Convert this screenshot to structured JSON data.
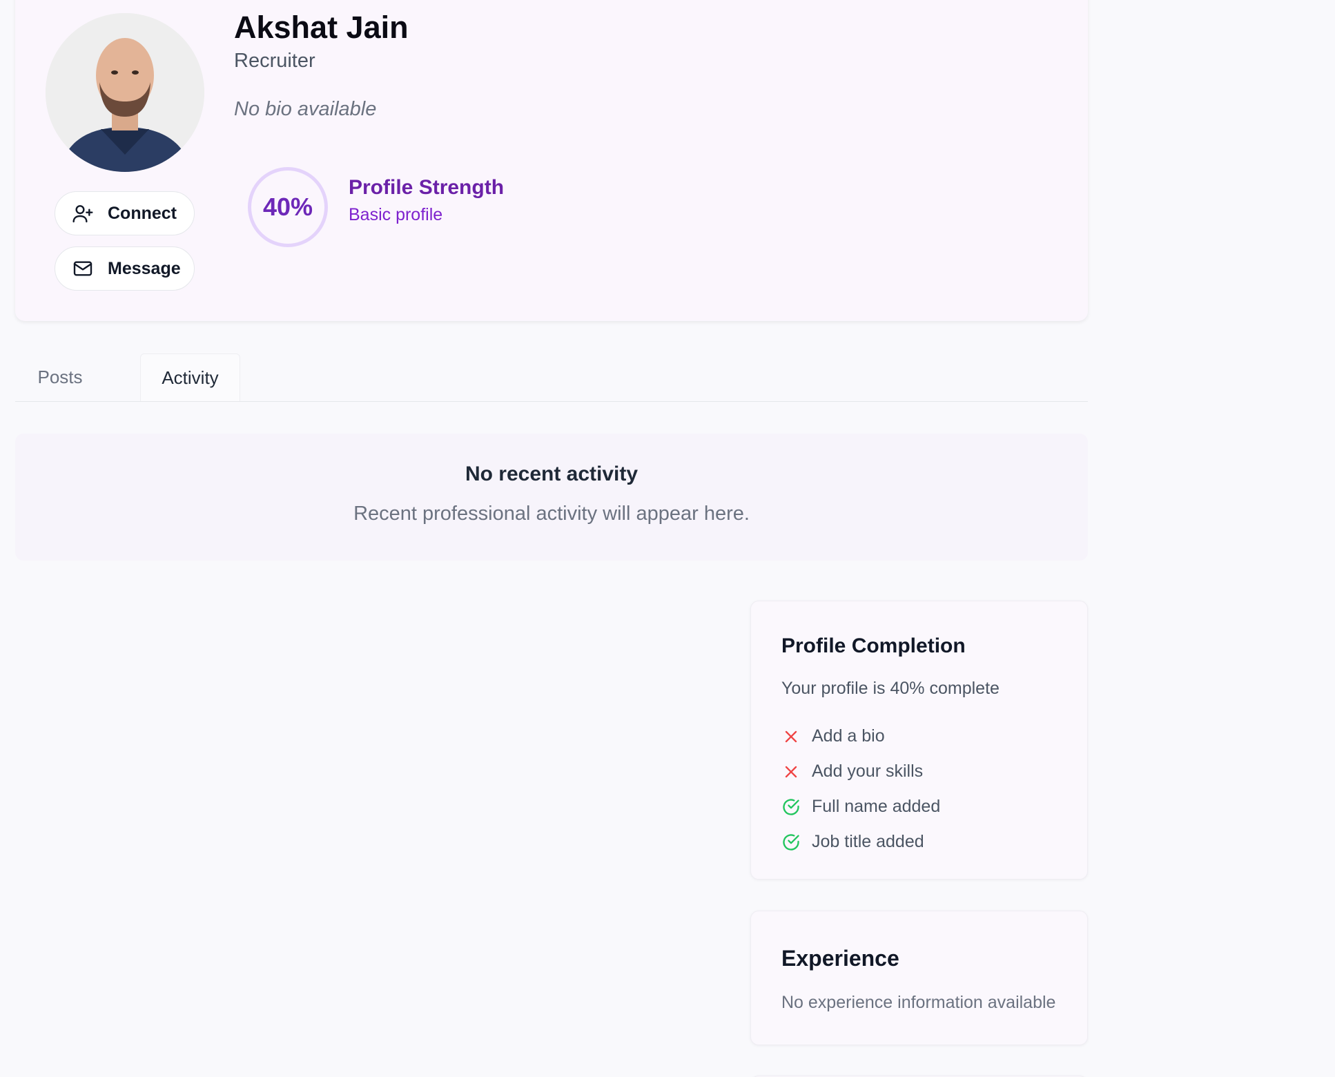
{
  "profile": {
    "name": "Akshat Jain",
    "role": "Recruiter",
    "bio": "No bio available",
    "avatar_icon": "user-photo",
    "connect_label": "Connect",
    "message_label": "Message",
    "strength": {
      "percent_label": "40%",
      "percent": 40,
      "title": "Profile Strength",
      "subtitle": "Basic profile"
    }
  },
  "tabs": [
    {
      "label": "Posts",
      "active": false
    },
    {
      "label": "Activity",
      "active": true
    }
  ],
  "activity": {
    "title": "No recent activity",
    "subtitle": "Recent professional activity will appear here."
  },
  "completion": {
    "title": "Profile Completion",
    "subtitle": "Your profile is 40% complete",
    "items": [
      {
        "label": "Add a bio",
        "done": false
      },
      {
        "label": "Add your skills",
        "done": false
      },
      {
        "label": "Full name added",
        "done": true
      },
      {
        "label": "Job title added",
        "done": true
      }
    ]
  },
  "experience": {
    "title": "Experience",
    "empty_text": "No experience information available"
  },
  "colors": {
    "accent": "#6b21a8",
    "ring": "#e4d3fb",
    "error": "#ef4444",
    "success": "#22c55e"
  }
}
